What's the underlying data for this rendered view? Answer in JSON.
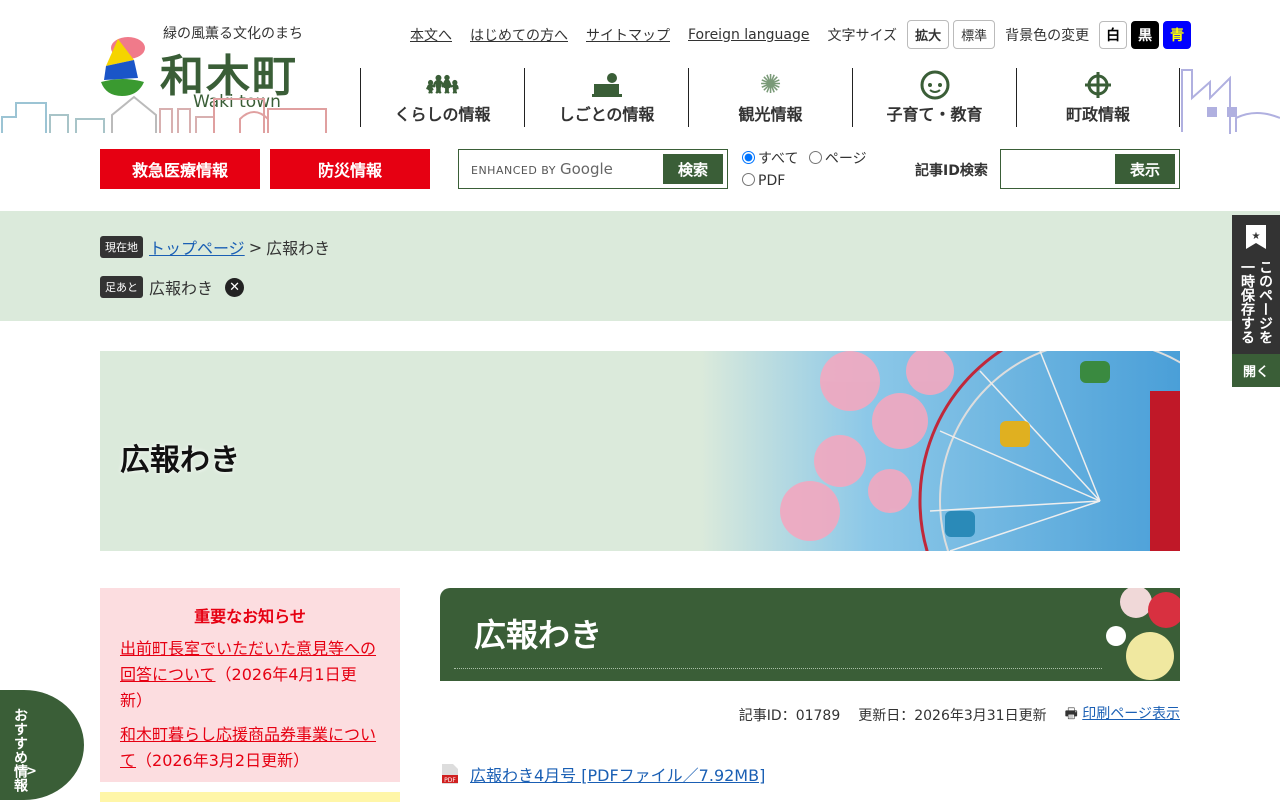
{
  "header": {
    "tagline": "緑の風薫る文化のまち",
    "site_name": "和木町",
    "site_name_en": "Waki town"
  },
  "util": {
    "links": [
      "本文へ",
      "はじめての方へ",
      "サイトマップ",
      "Foreign language"
    ],
    "font_size_label": "文字サイズ",
    "font_large": "拡大",
    "font_normal": "標準",
    "bg_label": "背景色の変更",
    "bg_white": "白",
    "bg_black": "黒",
    "bg_blue": "青"
  },
  "gnav": [
    {
      "label": "くらしの情報",
      "icon": "family-icon"
    },
    {
      "label": "しごとの情報",
      "icon": "work-icon"
    },
    {
      "label": "観光情報",
      "icon": "fireworks-icon"
    },
    {
      "label": "子育て・教育",
      "icon": "child-face-icon"
    },
    {
      "label": "町政情報",
      "icon": "town-emblem-icon"
    }
  ],
  "buttons": {
    "emergency": "救急医療情報",
    "disaster": "防災情報"
  },
  "search": {
    "placeholder_prefix": "ENHANCED BY",
    "placeholder_brand": "Google",
    "button": "検索",
    "radio_all": "すべて",
    "radio_page": "ページ",
    "radio_pdf": "PDF",
    "selected": "すべて",
    "id_label": "記事ID検索",
    "id_button": "表示"
  },
  "breadcrumb": {
    "here_tag": "現在地",
    "top": "トップページ",
    "sep": ">",
    "current": "広報わき",
    "history_tag": "足あと",
    "history_item": "広報わき"
  },
  "side_tab": {
    "label": "このページを一時保存する",
    "open": "開く"
  },
  "hero": {
    "title": "広報わき"
  },
  "notice": {
    "title": "重要なお知らせ",
    "items": [
      {
        "link": "出前町長室でいただいた意見等への回答について",
        "date": "（2026年4月1日更新）"
      },
      {
        "link": "和木町暮らし応援商品券事業について",
        "date": "（2026年3月2日更新）"
      }
    ]
  },
  "recommend": {
    "label": "おすすめ情報",
    "arrow": ">"
  },
  "article": {
    "title": "広報わき",
    "id": "記事ID：01789",
    "updated": "更新日：2026年3月31日更新",
    "print": "印刷ページ表示",
    "pdf_link": "広報わき4月号 [PDFファイル／7.92MB]"
  },
  "colors": {
    "brand_green": "#3a5e37",
    "red": "#e60012",
    "light_green": "#dbeadb",
    "link": "#1a5fb4"
  }
}
